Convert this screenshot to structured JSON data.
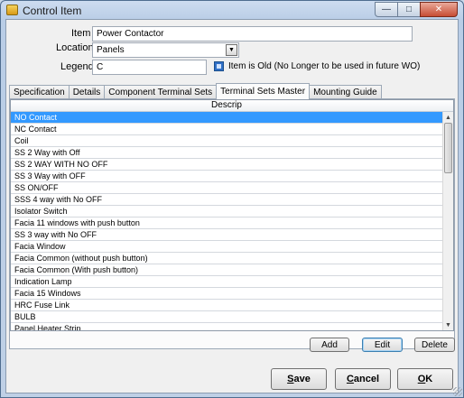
{
  "window": {
    "title": "Control Item",
    "minimize_glyph": "—",
    "maximize_glyph": "□",
    "close_glyph": "✕"
  },
  "form": {
    "item_label": "Item",
    "item_value": "Power Contactor",
    "location_label": "Location",
    "location_value": "Panels",
    "legend_label": "Legend",
    "legend_value": "C",
    "is_old_label": "Item is Old (No Longer to be used in future WO)",
    "is_old_checked": true
  },
  "tabs": [
    {
      "label": "Specification",
      "active": false
    },
    {
      "label": "Details",
      "active": false
    },
    {
      "label": "Component Terminal Sets",
      "active": false
    },
    {
      "label": "Terminal Sets Master",
      "active": true
    },
    {
      "label": "Mounting Guide",
      "active": false
    }
  ],
  "grid": {
    "column_header": "Descrip",
    "rows": [
      "NO Contact",
      "NC Contact",
      "Coil",
      "SS 2 Way with Off",
      "SS 2 WAY WITH NO OFF",
      "SS 3 Way with OFF",
      "SS ON/OFF",
      "SSS 4 way with No OFF",
      "Isolator Switch",
      "Facia 11 windows with push button",
      "SS 3 way with No OFF",
      "Facia Window",
      "Facia Common (without push button)",
      "Facia Common (With push button)",
      "Indication Lamp",
      "Facia 15 Windows",
      "HRC Fuse Link",
      "BULB",
      "Panel Heater Strip"
    ],
    "selected_index": 0
  },
  "grid_buttons": {
    "add": "Add",
    "edit": "Edit",
    "delete": "Delete"
  },
  "dialog_buttons": {
    "save": "Save",
    "cancel": "Cancel",
    "ok": "OK"
  },
  "colors": {
    "selection": "#3399ff",
    "checkbox": "#2f6fc6"
  }
}
